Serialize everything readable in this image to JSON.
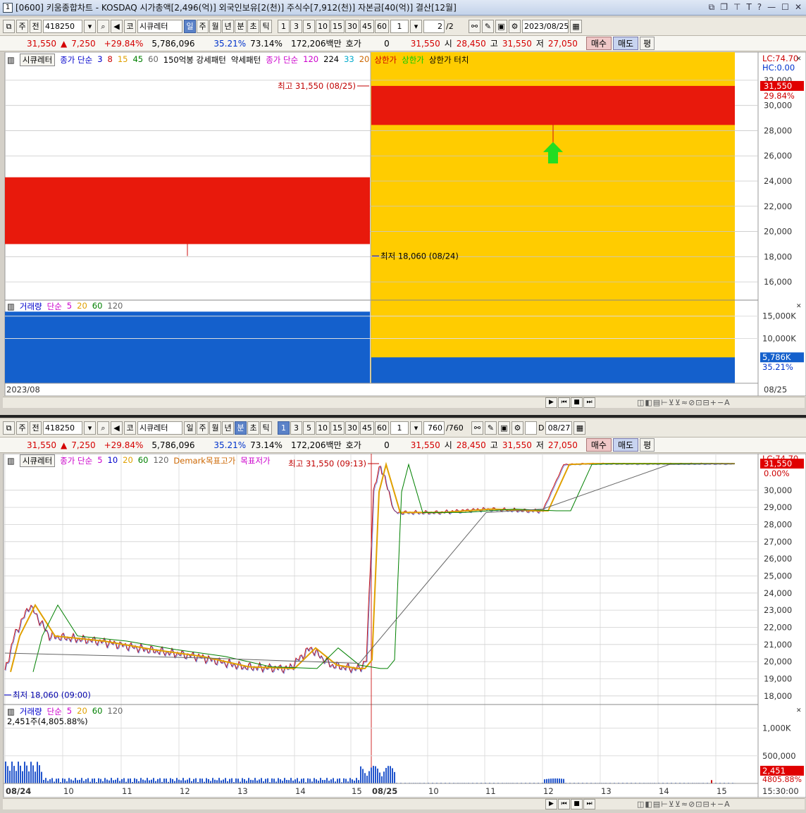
{
  "title": "[0600] 키움종합차트 - KOSDAQ 시가총액[2,496(억)] 외국인보유[2(천)] 주식수[7,912(천)] 자본금[40(억)] 결산[12월]",
  "window_num": "1",
  "title_buttons": [
    "⧉",
    "❐",
    "⊤",
    "T",
    "?",
    "—",
    "☐",
    "✕"
  ],
  "toolbar1": {
    "period": "주",
    "prev": "전",
    "code": "418250",
    "name": "시큐레터",
    "tabs": [
      "일",
      "주",
      "월",
      "년",
      "분",
      "초",
      "틱"
    ],
    "active_tab": "일",
    "nums": [
      "1",
      "3",
      "5",
      "10",
      "15",
      "30",
      "45",
      "60"
    ],
    "unit": "1",
    "page": "2",
    "page_total": "/2",
    "date": "2023/08/25"
  },
  "toolbar2": {
    "period": "주",
    "prev": "전",
    "code": "418250",
    "name": "시큐레터",
    "tabs": [
      "일",
      "주",
      "월",
      "년",
      "분",
      "초",
      "틱"
    ],
    "active_tab": "분",
    "nums": [
      "1",
      "3",
      "5",
      "10",
      "15",
      "30",
      "45",
      "60"
    ],
    "active_num": "1",
    "unit": "1",
    "page": "760",
    "page_total": "/760",
    "date_chk": "D",
    "date": "08/27"
  },
  "quote": {
    "price": "31,550",
    "change": "7,250",
    "rate": "+29.84%",
    "volume": "5,786,096",
    "pct1": "35.21%",
    "pct2": "73.14%",
    "amount": "172,206백만",
    "hoga_label": "호가",
    "hoga": "0",
    "price2": "31,550",
    "open_label": "시",
    "open": "28,450",
    "high_label": "고",
    "high": "31,550",
    "low_label": "저",
    "low": "27,050",
    "buy": "매수",
    "sell": "매도",
    "flat": "평"
  },
  "top_chart": {
    "legend_name": "시큐레터",
    "legend": [
      {
        "t": "종가 단순",
        "c": "#0000cc"
      },
      {
        "t": "3",
        "c": "#0000cc"
      },
      {
        "t": "8",
        "c": "#cc0000"
      },
      {
        "t": "15",
        "c": "#e0a000"
      },
      {
        "t": "45",
        "c": "#008000"
      },
      {
        "t": "60",
        "c": "#666666"
      },
      {
        "t": "150억봉 강세패턴",
        "c": "#000000"
      },
      {
        "t": "약세패턴",
        "c": "#000000"
      },
      {
        "t": "종가 단순",
        "c": "#cc00cc"
      },
      {
        "t": "120",
        "c": "#cc00cc"
      },
      {
        "t": "224",
        "c": "#000000"
      },
      {
        "t": "33",
        "c": "#00aacc"
      },
      {
        "t": "20",
        "c": "#cc6600"
      },
      {
        "t": "상한가",
        "c": "#cc0000"
      },
      {
        "t": "상한가",
        "c": "#00cc00"
      },
      {
        "t": "상한가 터치",
        "c": "#000000"
      }
    ],
    "high_note": "최고 31,550 (08/25)",
    "low_note": "최저 18,060 (08/24)",
    "lc": "LC:74.70",
    "hc": "HC:0.00",
    "price_tag": "31,550",
    "price_pct": "29.84%",
    "y_ticks": [
      "32,000",
      "30,000",
      "28,000",
      "26,000",
      "24,000",
      "22,000",
      "20,000",
      "18,000",
      "16,000"
    ],
    "vol_legend": [
      {
        "t": "거래량",
        "c": "#0000cc"
      },
      {
        "t": "단순",
        "c": "#cc00cc"
      },
      {
        "t": "5",
        "c": "#cc00cc"
      },
      {
        "t": "20",
        "c": "#e0a000"
      },
      {
        "t": "60",
        "c": "#008000"
      },
      {
        "t": "120",
        "c": "#666666"
      }
    ],
    "vol_ticks": [
      "15,000K",
      "10,000K"
    ],
    "vol_tag": "5,786K",
    "vol_pct": "35.21%",
    "x_left": "2023/08",
    "x_right": "08/25"
  },
  "bottom_chart": {
    "legend_name": "시큐레터",
    "legend": [
      {
        "t": "종가 단순",
        "c": "#cc00cc"
      },
      {
        "t": "5",
        "c": "#cc00cc"
      },
      {
        "t": "10",
        "c": "#0000cc"
      },
      {
        "t": "20",
        "c": "#e0a000"
      },
      {
        "t": "60",
        "c": "#008000"
      },
      {
        "t": "120",
        "c": "#666666"
      },
      {
        "t": "Demark목표고가",
        "c": "#cc6600"
      },
      {
        "t": "목표저가",
        "c": "#cc00cc"
      }
    ],
    "high_note": "최고 31,550 (09:13)",
    "low_note": "최저 18,060 (09:00)",
    "lc": "LC:74.70",
    "price_tag": "31,550",
    "price_pct": "0.00%",
    "y_ticks": [
      "30,000",
      "29,000",
      "28,000",
      "27,000",
      "26,000",
      "25,000",
      "24,000",
      "23,000",
      "22,000",
      "21,000",
      "20,000",
      "19,000",
      "18,000"
    ],
    "vol_legend": [
      {
        "t": "거래량",
        "c": "#0000cc"
      },
      {
        "t": "단순",
        "c": "#cc00cc"
      },
      {
        "t": "5",
        "c": "#cc00cc"
      },
      {
        "t": "20",
        "c": "#e0a000"
      },
      {
        "t": "60",
        "c": "#008000"
      },
      {
        "t": "120",
        "c": "#666666"
      }
    ],
    "vol_info": "2,451주(4,805.88%)",
    "vol_ticks": [
      "1,000K",
      "500,000"
    ],
    "vol_tag": "2,451",
    "vol_pct": "4805.88%",
    "x_labels": [
      "08/24",
      "10",
      "11",
      "12",
      "13",
      "14",
      "15",
      "08/25",
      "10",
      "11",
      "12",
      "13",
      "14",
      "15"
    ],
    "x_right": "15:30:00"
  },
  "chart_data": [
    {
      "type": "candlestick",
      "categories": [
        "08/24",
        "08/25"
      ],
      "open": [
        18060,
        28450
      ],
      "high": [
        24270,
        31550
      ],
      "low": [
        18060,
        27050
      ],
      "close": [
        24300,
        31550
      ],
      "volume_k": [
        16000,
        5786
      ],
      "ylim": [
        15000,
        33000
      ]
    },
    {
      "type": "line",
      "x_labels": [
        "08/24",
        "10",
        "11",
        "12",
        "13",
        "14",
        "15",
        "08/25",
        "10",
        "11",
        "12",
        "13",
        "14",
        "15"
      ],
      "price_path": [
        19400,
        21500,
        23300,
        21500,
        21200,
        20700,
        20300,
        19700,
        19600,
        20800,
        19800,
        19600,
        19600,
        20100,
        29900,
        31500,
        28700,
        28700,
        28900,
        28800,
        28800,
        31500,
        31550,
        31550,
        31550
      ],
      "ylim": [
        17500,
        31800
      ]
    }
  ],
  "scroll_icons": [
    "▶",
    "⏮",
    "■",
    "⏭"
  ]
}
